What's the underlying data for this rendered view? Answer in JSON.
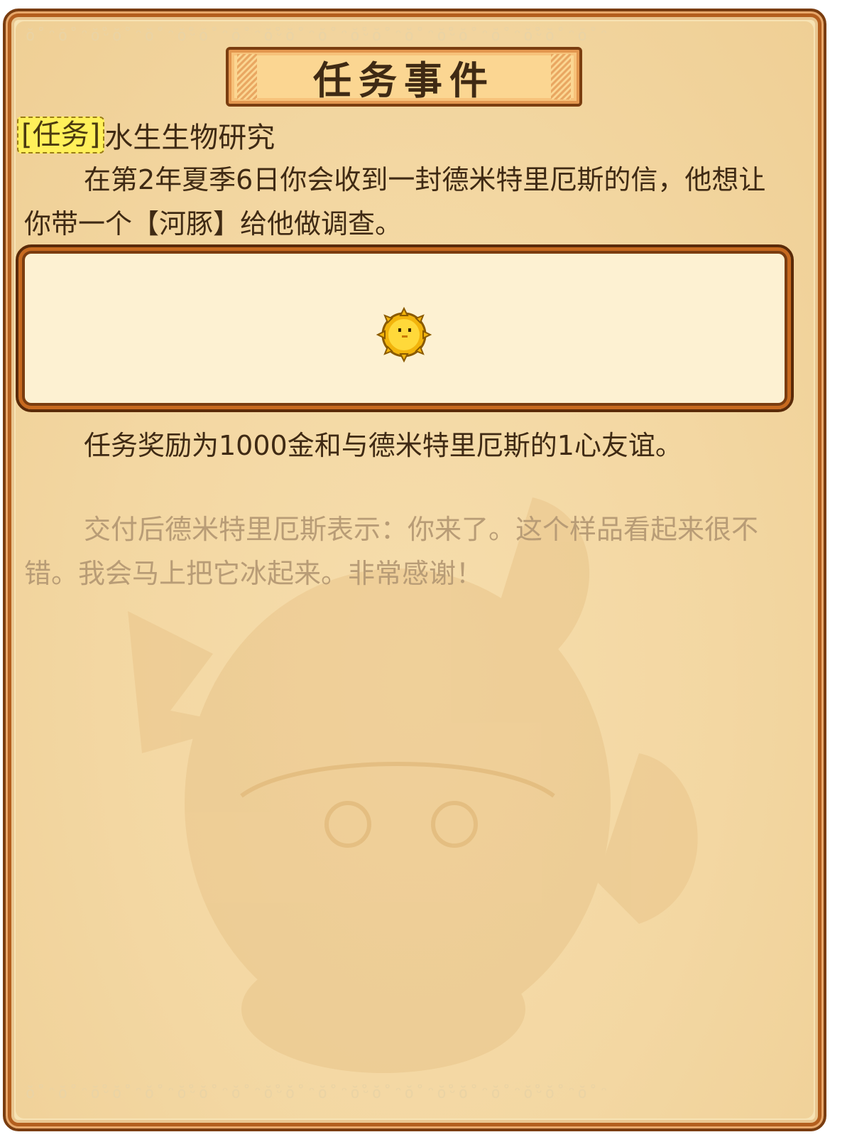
{
  "panel": {
    "title": "任务事件"
  },
  "quest": {
    "tag": "[任务]",
    "name": "水生生物研究"
  },
  "description": {
    "line1": "在第2年夏季6日你会收到一封德米特里厄斯的信，他想让你带一个【河豚】给他做调查。"
  },
  "required_item": {
    "icon": "pufferfish-icon"
  },
  "reward": {
    "text": "任务奖励为1000金和与德米特里厄斯的1心友谊。"
  },
  "completion": {
    "text": "交付后德米特里厄斯表示：你来了。这个样品看起来很不错。我会马上把它冰起来。非常感谢！"
  },
  "colors": {
    "parchment": "#f7e3b4",
    "frame_brown": "#7a3d10",
    "frame_orange": "#c76a1f",
    "tag_yellow": "#fff05a",
    "text_dark": "#3f2a14",
    "text_faded": "#b89c76"
  }
}
